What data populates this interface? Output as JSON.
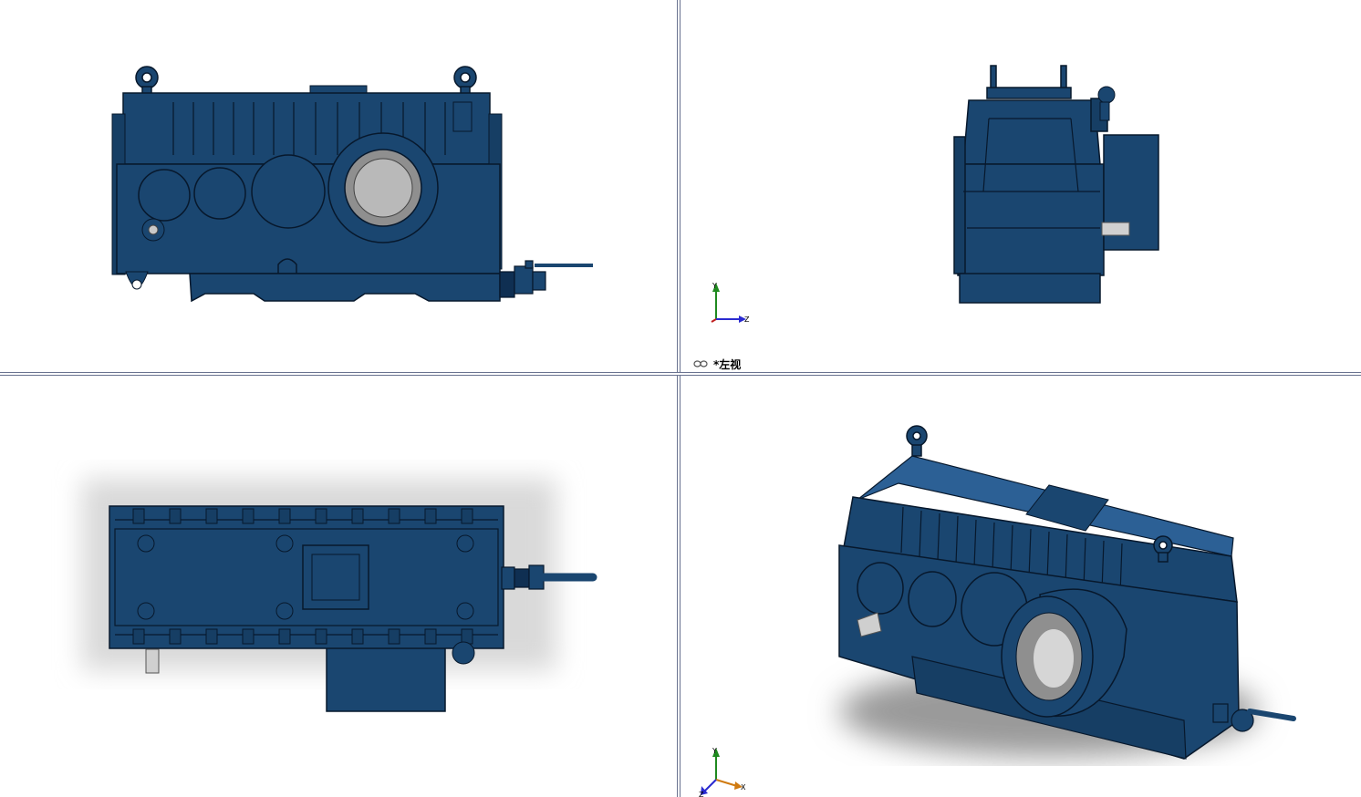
{
  "views": {
    "front": {
      "name": ""
    },
    "left": {
      "name": "*左视"
    },
    "top": {
      "name": ""
    },
    "iso": {
      "name": ""
    }
  },
  "triad": {
    "x": "X",
    "y": "Y",
    "z": "Z"
  },
  "icons": {
    "view_label_icon": "glasses-icon",
    "triad": "coordinate-triad-icon"
  },
  "colors": {
    "body": "#1a4670",
    "body_dark": "#0f2f52",
    "body_light": "#2c6095",
    "edge": "#07182c",
    "bore": "#b9b9b9",
    "divider": "#6a7390"
  }
}
